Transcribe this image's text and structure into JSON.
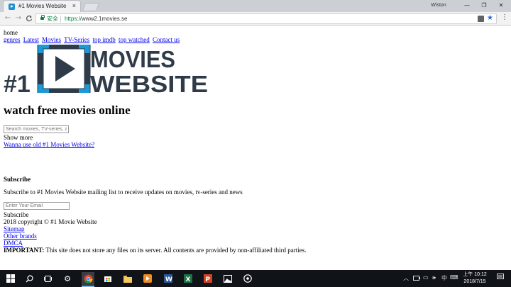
{
  "browser": {
    "tab_title": "#1 Movies Website - W",
    "tab_close": "×",
    "window_user": "Wiston",
    "secure_label": "安全",
    "url_scheme": "https://",
    "url_host": "www2.1movies.se",
    "back": "←",
    "forward": "→",
    "reload": "C",
    "minimize": "—",
    "maximize": "❐",
    "close": "✕",
    "star": "★",
    "menu": "⋮"
  },
  "page": {
    "home": "home",
    "nav": [
      "genres",
      "Latest",
      "Movies",
      "TV-Series",
      "top imdb",
      "top watched",
      "Contact us"
    ],
    "logo": {
      "number": "#1",
      "line1": "MOVIES",
      "line2": "WEBSITE"
    },
    "heading": "watch free movies online",
    "search_placeholder": "Search movies, TV-series, a",
    "show_more": "Show more",
    "old_site_link": "Wanna use old #1 Movies Website?",
    "subscribe_heading": "Subscribe",
    "subscribe_text": "Subscribe to #1 Movies Website mailing list to receive updates on movies, tv-series and news",
    "email_placeholder": "Enter Your Email",
    "subscribe_button": "Subscribe",
    "copyright": "2018 copyright © #1 Movie Website",
    "footer_links": [
      "Sitemap",
      "Other brands",
      "DMCA"
    ],
    "important_label": "IMPORTANT:",
    "important_text": " This site does not store any files on its server. All contents are provided by non-affiliated third parties."
  },
  "colors": {
    "logo": "#2f3b48",
    "logo_accent": "#1a9ad6",
    "link": "#0000ee",
    "secure": "#0b8043"
  },
  "taskbar": {
    "time": "上午 10:12",
    "date": "2018/7/15",
    "icons": [
      "windows-icon",
      "search-icon",
      "task-view-icon",
      "settings-icon",
      "chrome-icon",
      "store-icon",
      "file-explorer-icon",
      "media-player-icon",
      "word-icon",
      "excel-icon",
      "powerpoint-icon",
      "photos-icon",
      "groove-music-icon"
    ]
  }
}
